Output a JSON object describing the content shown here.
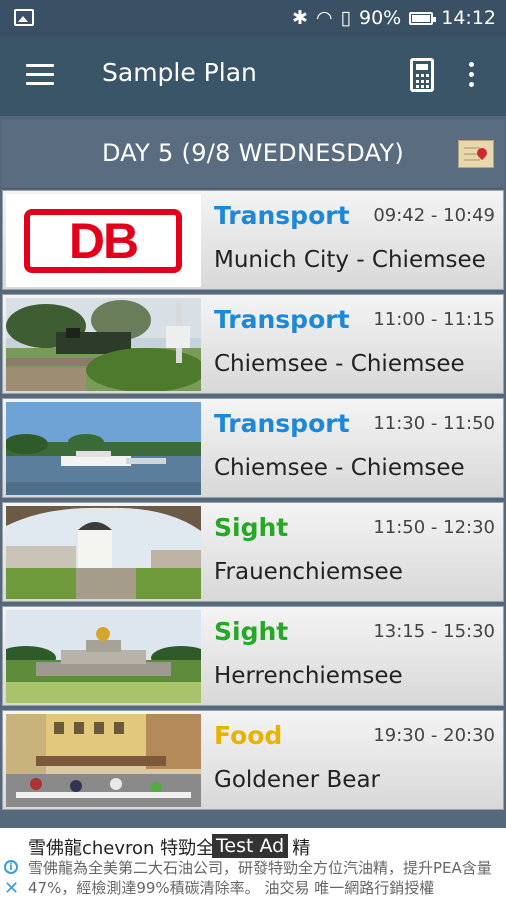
{
  "status_bar": {
    "battery": "90%",
    "time": "14:12"
  },
  "app_bar": {
    "title": "Sample Plan"
  },
  "day_header": {
    "title": "DAY 5 (9/8 WEDNESDAY)"
  },
  "colors": {
    "transport": "#1e88d8",
    "sight": "#26a826",
    "food": "#e8b200"
  },
  "items": [
    {
      "category": "Transport",
      "time": "09:42 - 10:49",
      "place": "Munich City - Chiemsee",
      "thumb": "db-logo"
    },
    {
      "category": "Transport",
      "time": "11:00 - 11:15",
      "place": "Chiemsee - Chiemsee",
      "thumb": "steam-train"
    },
    {
      "category": "Transport",
      "time": "11:30 - 11:50",
      "place": "Chiemsee - Chiemsee",
      "thumb": "lake-boat"
    },
    {
      "category": "Sight",
      "time": "11:50 - 12:30",
      "place": "Frauenchiemsee",
      "thumb": "abbey-tower"
    },
    {
      "category": "Sight",
      "time": "13:15 - 15:30",
      "place": "Herrenchiemsee",
      "thumb": "palace-fountain"
    },
    {
      "category": "Food",
      "time": "19:30 - 20:30",
      "place": "Goldener Bear",
      "thumb": "street-cafe"
    }
  ],
  "ad": {
    "headline": "雪佛龍chevron 特勁全",
    "headline_tail": "精",
    "label": "Test Ad",
    "body": "雪佛龍為全美第二大石油公司，研發特勁全方位汽油精，提升PEA含量47%，經檢測達99%積碳清除率。 油交易 唯一網路行銷授權"
  }
}
